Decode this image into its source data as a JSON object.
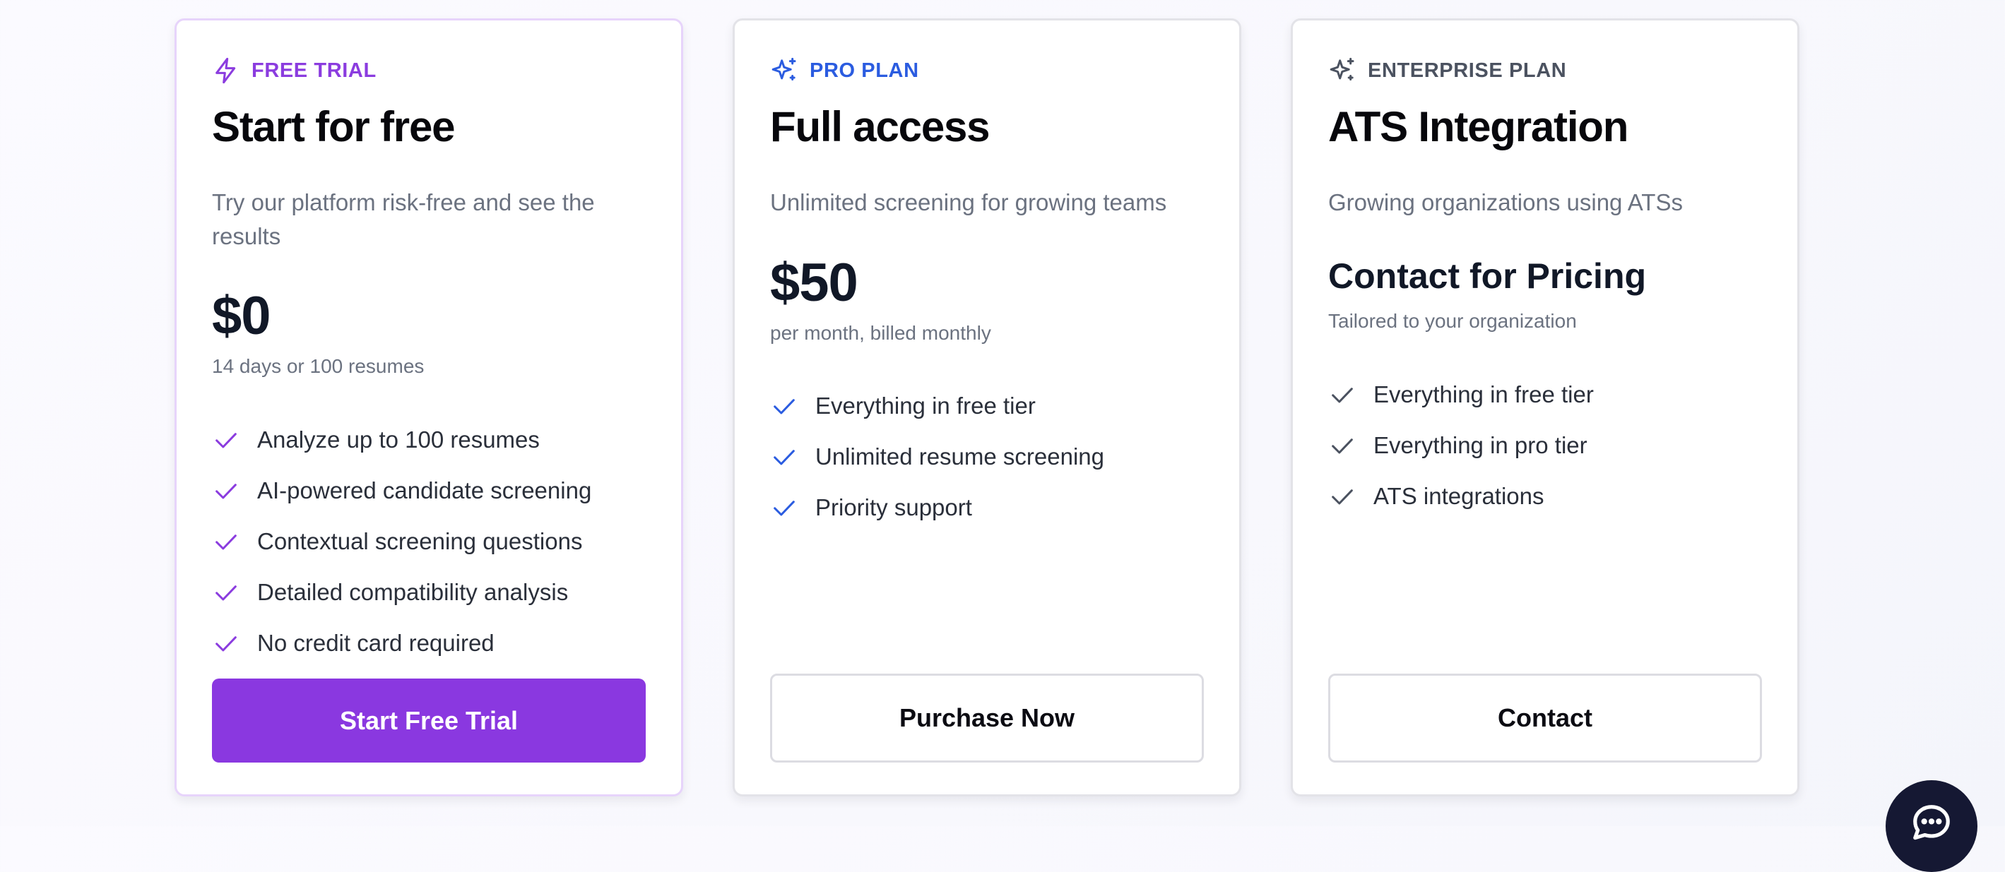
{
  "colors": {
    "trial_accent": "#8b3cdf",
    "pro_accent": "#2b5ce0",
    "enterprise_accent": "#4b5260",
    "trial_button_bg": "#8a38e0",
    "chat_bg": "#151833"
  },
  "plans": {
    "trial": {
      "icon": "lightning-bolt-icon",
      "tag": "FREE TRIAL",
      "title": "Start for free",
      "subtitle": "Try our platform risk-free and see the results",
      "price": "$0",
      "price_note": "14 days or 100 resumes",
      "features": [
        "Analyze up to 100 resumes",
        "AI-powered candidate screening",
        "Contextual screening questions",
        "Detailed compatibility analysis",
        "No credit card required"
      ],
      "button_label": "Start Free Trial"
    },
    "pro": {
      "icon": "sparkles-icon",
      "tag": "PRO PLAN",
      "title": "Full access",
      "subtitle": "Unlimited screening for growing teams",
      "price": "$50",
      "price_note": "per month, billed monthly",
      "features": [
        "Everything in free tier",
        "Unlimited resume screening",
        "Priority support"
      ],
      "button_label": "Purchase Now"
    },
    "enterprise": {
      "icon": "sparkles-icon",
      "tag": "ENTERPRISE PLAN",
      "title": "ATS Integration",
      "subtitle": "Growing organizations using ATSs",
      "price": "Contact for Pricing",
      "price_note": "Tailored to your organization",
      "features": [
        "Everything in free tier",
        "Everything in pro tier",
        "ATS integrations"
      ],
      "button_label": "Contact"
    }
  },
  "chat_widget": {
    "icon": "chat-bubble-icon"
  }
}
